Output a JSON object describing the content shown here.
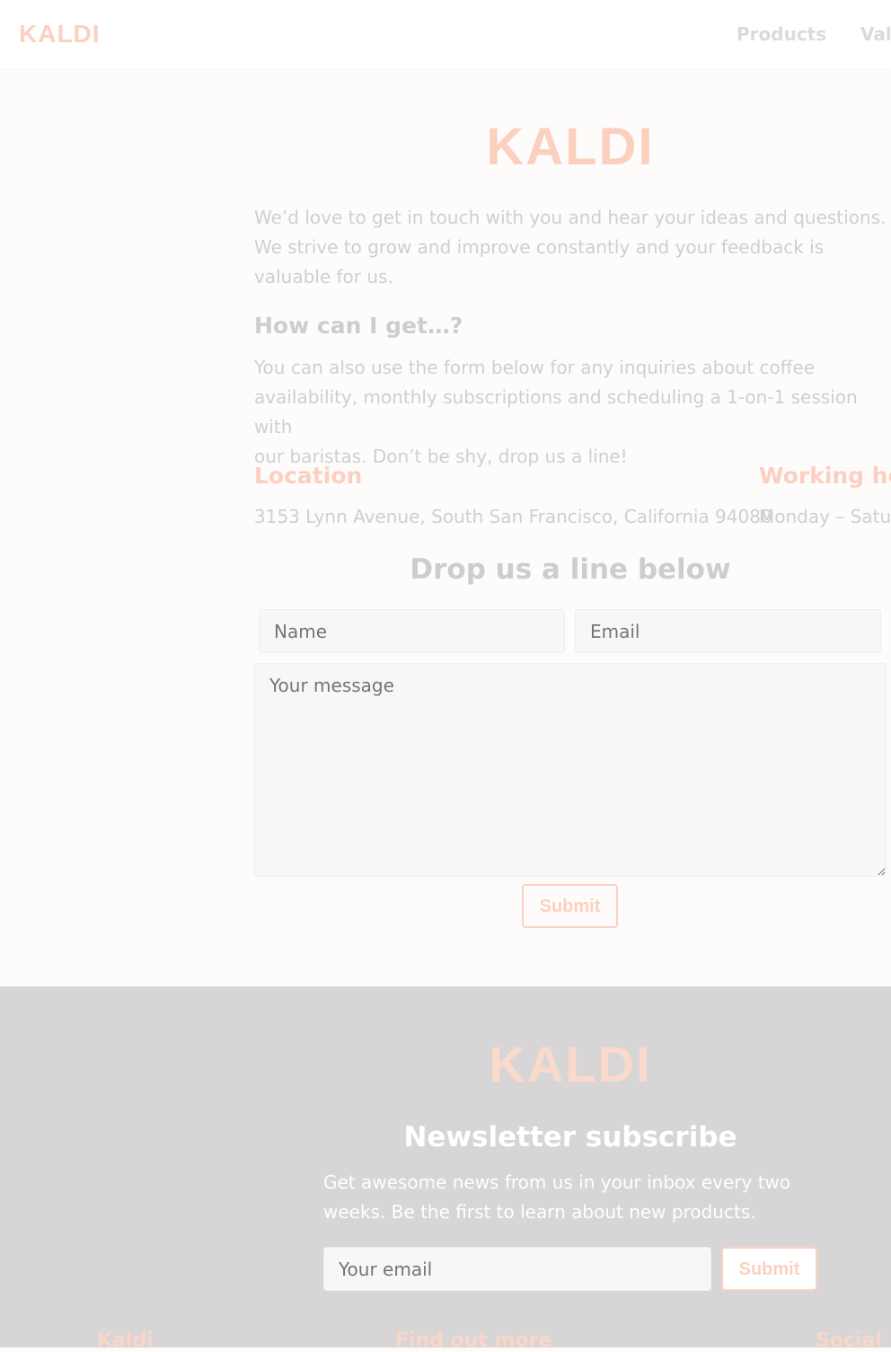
{
  "brand": {
    "name": "KALDI",
    "accent": "#fbd1c0"
  },
  "nav": {
    "items": [
      "Products",
      "Val"
    ]
  },
  "hero": {
    "title": "KALDI"
  },
  "intro": {
    "lines": [
      "We’d love to get in touch with you and hear your ideas and questions.",
      "We strive to grow and improve constantly and your feedback is",
      "valuable for us."
    ]
  },
  "faq": {
    "heading": "How can I get…?",
    "lines": [
      "You can also use the form below for any inquiries about coffee",
      "availability, monthly subscriptions and scheduling a 1-on-1 session with",
      "our baristas. Don’t be shy, drop us a line!"
    ]
  },
  "location": {
    "heading": "Location",
    "address": "3153 Lynn Avenue, South San Francisco, California 94080"
  },
  "hours": {
    "heading": "Working ho",
    "value": "Monday – Satu"
  },
  "contact_form": {
    "title": "Drop us a line below",
    "name_placeholder": "Name",
    "email_placeholder": "Email",
    "message_placeholder": "Your message",
    "submit_label": "Submit"
  },
  "footer": {
    "logo": "KALDI",
    "newsletter_title": "Newsletter subscribe",
    "newsletter_lines": [
      "Get awesome news from us in your inbox every two",
      "weeks. Be the first to learn about new products."
    ],
    "email_placeholder": "Your email",
    "submit_label": "Submit",
    "columns": [
      "Kaldi",
      "Find out more",
      "Social"
    ]
  }
}
